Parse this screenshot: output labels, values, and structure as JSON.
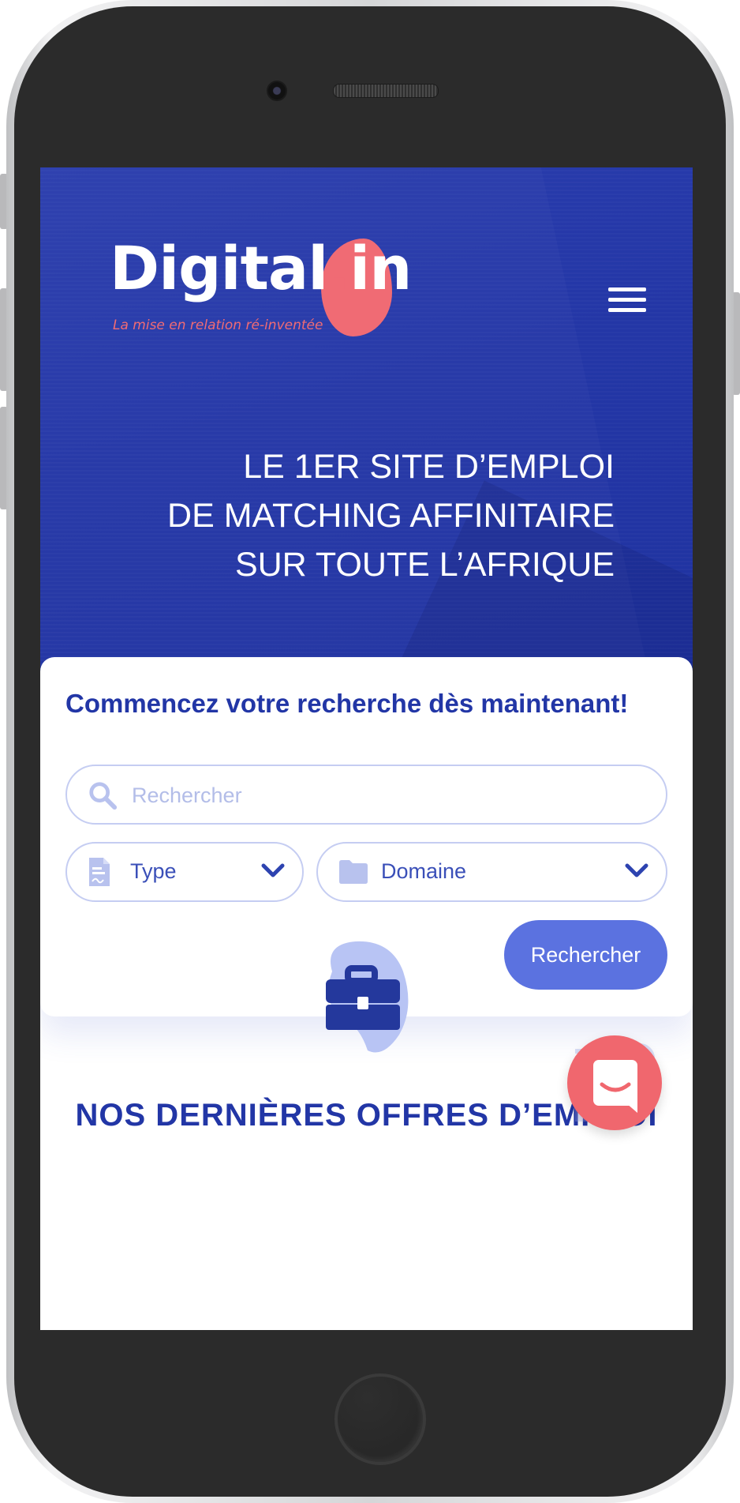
{
  "logo": {
    "text_main": "Digital",
    "text_dot": ".",
    "text_in": "in",
    "tagline": "La mise en relation ré-inventée"
  },
  "hero": {
    "headline_lines": [
      "LE 1ER SITE D’EMPLOI",
      "DE MATCHING AFFINITAIRE",
      "SUR TOUTE L’AFRIQUE"
    ]
  },
  "search": {
    "title": "Commencez votre recherche dès maintenant!",
    "placeholder": "Rechercher",
    "type_label": "Type",
    "domain_label": "Domaine",
    "submit_label": "Rechercher"
  },
  "offers": {
    "title": "NOS DERNIÈRES OFFRES D’EMPLOI"
  },
  "colors": {
    "brand_blue": "#2236a6",
    "accent_coral": "#f06b74",
    "button_blue": "#5b72e0"
  },
  "icons": [
    "menu-icon",
    "search-icon",
    "document-icon",
    "folder-icon",
    "chevron-down-icon",
    "briefcase-icon",
    "chat-icon"
  ]
}
